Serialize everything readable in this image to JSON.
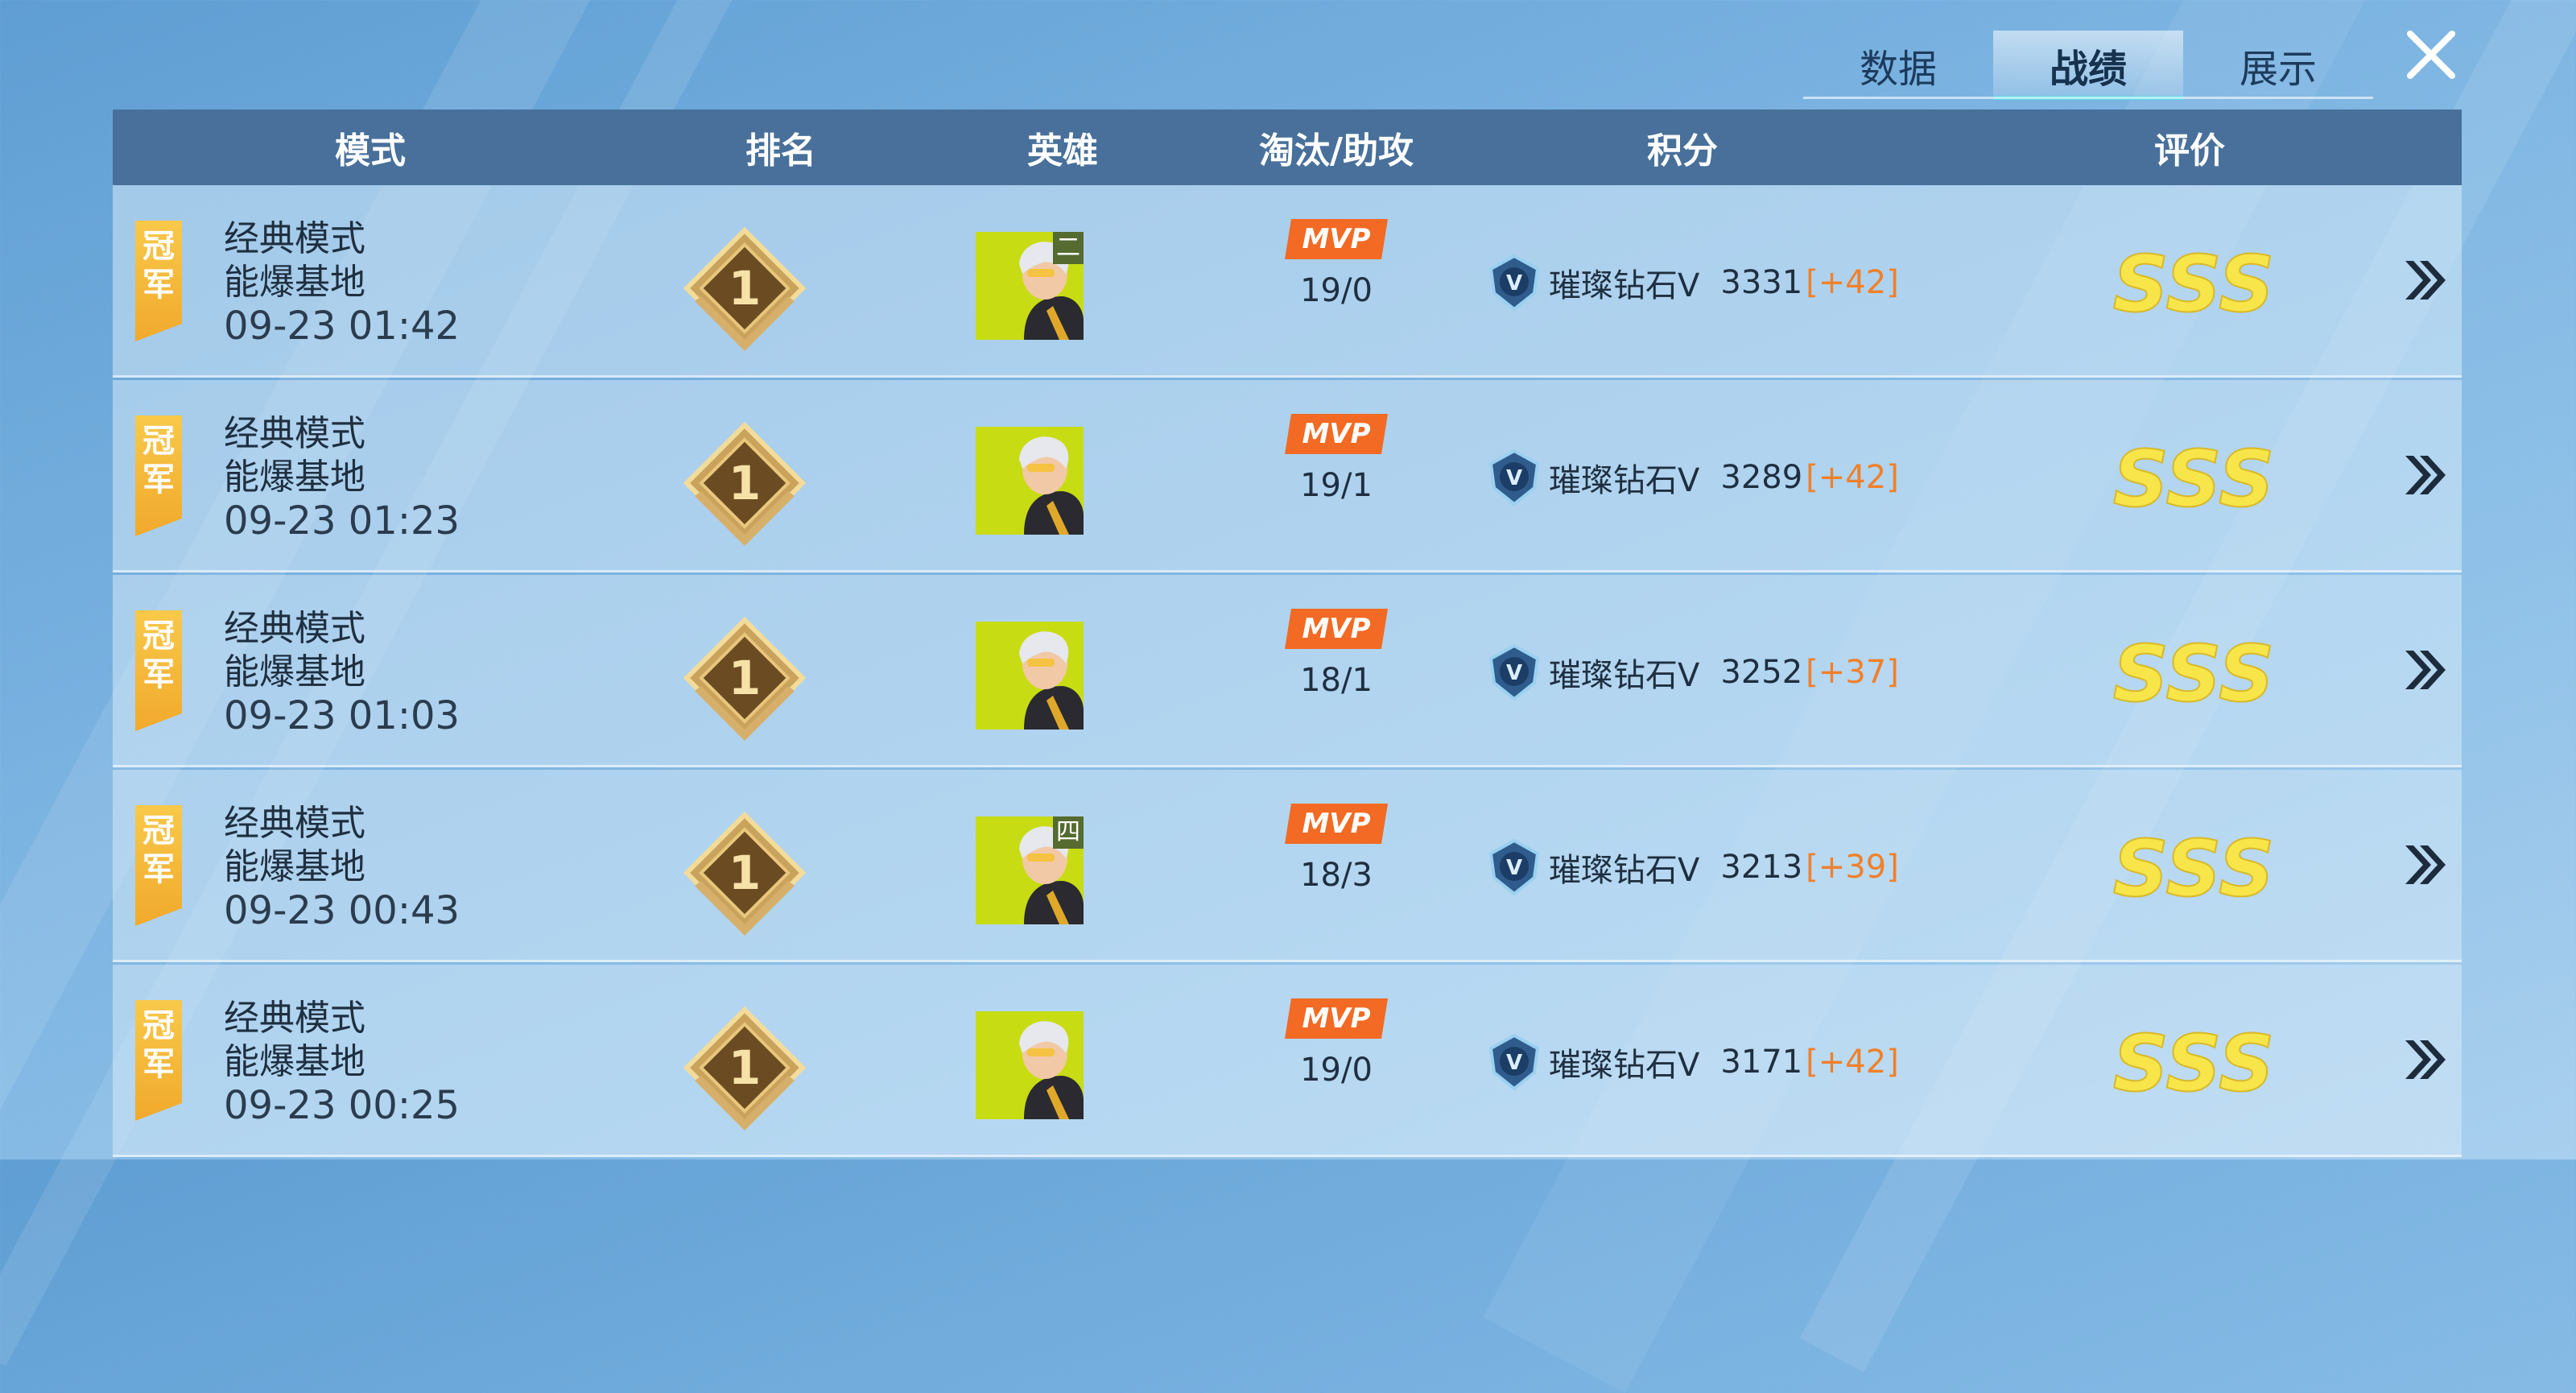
{
  "tabs": [
    {
      "label": "数据",
      "active": false
    },
    {
      "label": "战绩",
      "active": true
    },
    {
      "label": "展示",
      "active": false
    }
  ],
  "columns": {
    "mode": "模式",
    "rank": "排名",
    "hero": "英雄",
    "kda": "淘汰/助攻",
    "score": "积分",
    "rating": "评价"
  },
  "rows": [
    {
      "badge": "冠军",
      "mode": "经典模式",
      "map": "能爆基地",
      "time": "09-23 01:42",
      "rank": "1",
      "hero_tag": "二",
      "mvp": "MVP",
      "kda": "19/0",
      "tier": "璀璨钻石Ⅴ",
      "score": "3331",
      "delta": "[+42]",
      "grade": "SSS"
    },
    {
      "badge": "冠军",
      "mode": "经典模式",
      "map": "能爆基地",
      "time": "09-23 01:23",
      "rank": "1",
      "hero_tag": "",
      "mvp": "MVP",
      "kda": "19/1",
      "tier": "璀璨钻石Ⅴ",
      "score": "3289",
      "delta": "[+42]",
      "grade": "SSS"
    },
    {
      "badge": "冠军",
      "mode": "经典模式",
      "map": "能爆基地",
      "time": "09-23 01:03",
      "rank": "1",
      "hero_tag": "",
      "mvp": "MVP",
      "kda": "18/1",
      "tier": "璀璨钻石Ⅴ",
      "score": "3252",
      "delta": "[+37]",
      "grade": "SSS"
    },
    {
      "badge": "冠军",
      "mode": "经典模式",
      "map": "能爆基地",
      "time": "09-23 00:43",
      "rank": "1",
      "hero_tag": "四",
      "mvp": "MVP",
      "kda": "18/3",
      "tier": "璀璨钻石Ⅴ",
      "score": "3213",
      "delta": "[+39]",
      "grade": "SSS"
    },
    {
      "badge": "冠军",
      "mode": "经典模式",
      "map": "能爆基地",
      "time": "09-23 00:25",
      "rank": "1",
      "hero_tag": "",
      "mvp": "MVP",
      "kda": "19/0",
      "tier": "璀璨钻石Ⅴ",
      "score": "3171",
      "delta": "[+42]",
      "grade": "SSS"
    }
  ],
  "colors": {
    "header": "#48709a",
    "accent": "#5bd6e8",
    "delta": "#f0802a",
    "grade": "#f7e54a",
    "ribbon": "#f4b73a",
    "mvp": "#f26a23"
  }
}
